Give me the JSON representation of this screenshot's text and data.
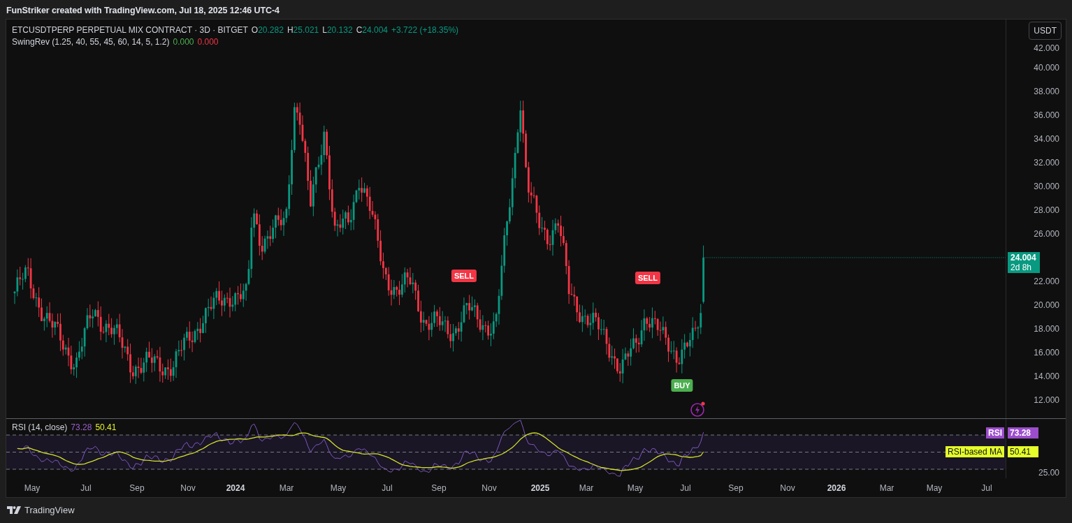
{
  "header": {
    "title": "FunStriker created with TradingView.com, Jul 18, 2025 12:46 UTC-4"
  },
  "legend": {
    "symbol": "ETCUSDTPERP PERPETUAL MIX CONTRACT · 3D · BITGET",
    "ohlc": [
      {
        "label": "O",
        "value": "20.282"
      },
      {
        "label": "H",
        "value": "25.021"
      },
      {
        "label": "L",
        "value": "20.132"
      },
      {
        "label": "C",
        "value": "24.004"
      }
    ],
    "change": "+3.722 (+18.35%)",
    "indicator": "SwingRev (1.25, 40, 55, 45, 60, 14, 5, 1.2)",
    "indicator_values": [
      {
        "value": "0.000",
        "color": "#4caf50"
      },
      {
        "value": "0.000",
        "color": "#f23645"
      }
    ]
  },
  "currency_button": "USDT",
  "price_axis": [
    "42.000",
    "40.000",
    "38.000",
    "36.000",
    "34.000",
    "32.000",
    "30.000",
    "28.000",
    "26.000",
    "22.000",
    "20.000",
    "18.000",
    "16.000",
    "14.000",
    "12.000"
  ],
  "last_price": {
    "value": "24.004",
    "countdown": "2d 8h"
  },
  "signals": [
    {
      "label": "SELL",
      "kind": "sell"
    },
    {
      "label": "SELL",
      "kind": "sell"
    },
    {
      "label": "BUY",
      "kind": "buy"
    }
  ],
  "rsi": {
    "title": "RSI (14, close)",
    "value": "73.28",
    "ma_value": "50.41",
    "tag_label": "RSI",
    "tag_value": "73.28",
    "ma_tag_label": "RSI-based MA",
    "ma_tag_value": "50.41",
    "axis_label": "25.00"
  },
  "time_axis": [
    {
      "label": "May",
      "kind": "month"
    },
    {
      "label": "Jul",
      "kind": "month"
    },
    {
      "label": "Sep",
      "kind": "month"
    },
    {
      "label": "Nov",
      "kind": "month"
    },
    {
      "label": "2024",
      "kind": "year"
    },
    {
      "label": "Mar",
      "kind": "month"
    },
    {
      "label": "May",
      "kind": "month"
    },
    {
      "label": "Jul",
      "kind": "month"
    },
    {
      "label": "Sep",
      "kind": "month"
    },
    {
      "label": "Nov",
      "kind": "month"
    },
    {
      "label": "2025",
      "kind": "year"
    },
    {
      "label": "Mar",
      "kind": "month"
    },
    {
      "label": "May",
      "kind": "month"
    },
    {
      "label": "Jul",
      "kind": "month"
    },
    {
      "label": "Sep",
      "kind": "month"
    },
    {
      "label": "Nov",
      "kind": "month"
    },
    {
      "label": "2026",
      "kind": "year"
    },
    {
      "label": "Mar",
      "kind": "month"
    },
    {
      "label": "May",
      "kind": "month"
    },
    {
      "label": "Jul",
      "kind": "month"
    }
  ],
  "footer": {
    "brand": "TradingView"
  }
}
